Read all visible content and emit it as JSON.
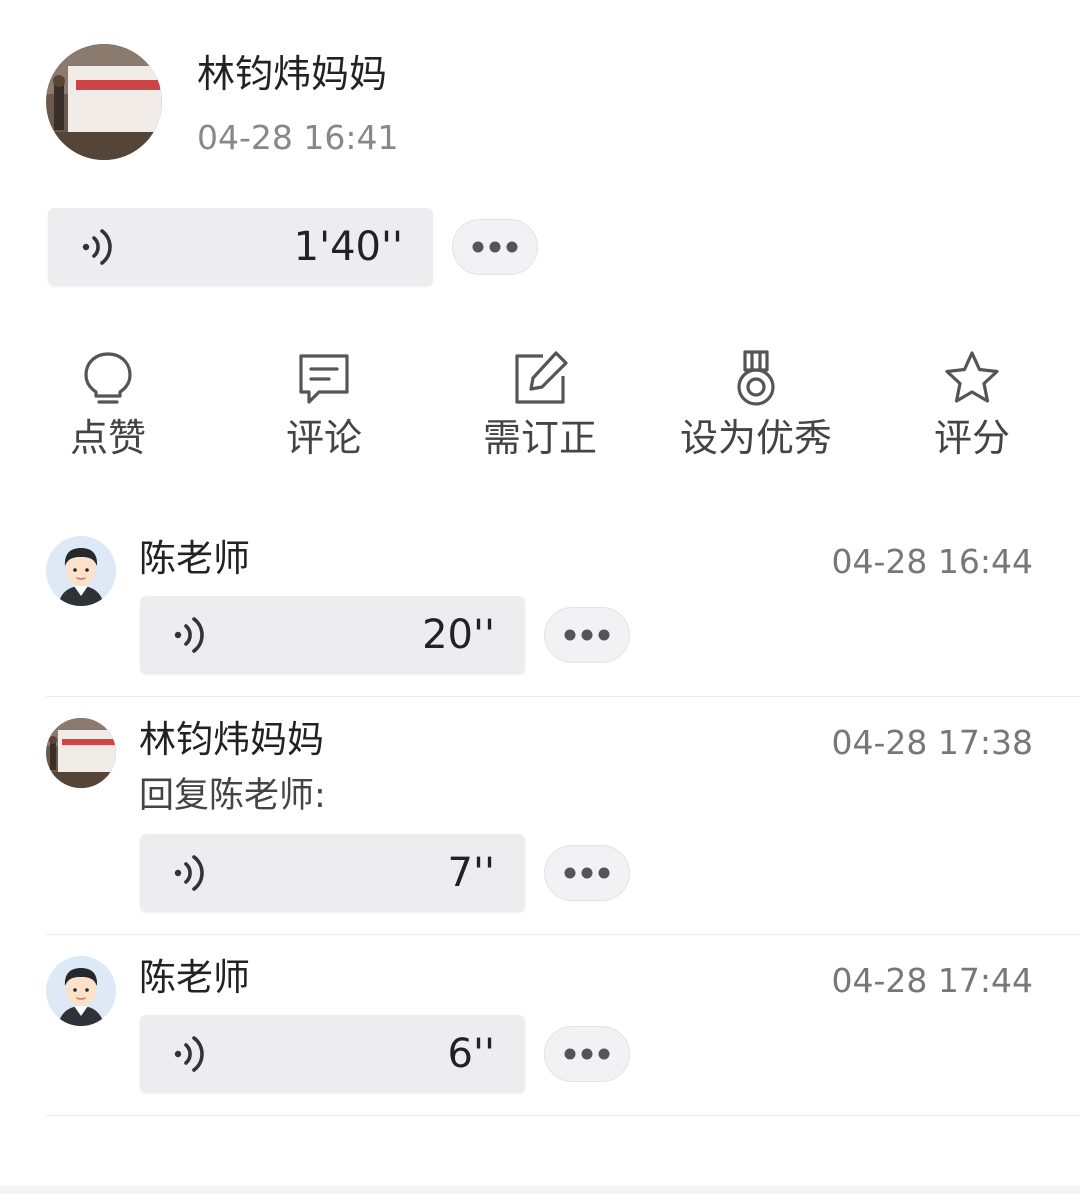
{
  "post": {
    "author": "林钧炜妈妈",
    "time": "04-28 16:41",
    "voice_duration": "1'40''",
    "avatar_icon": "photo-avatar"
  },
  "actions": [
    {
      "label": "点赞",
      "icon": "lightbulb-icon"
    },
    {
      "label": "评论",
      "icon": "comment-icon"
    },
    {
      "label": "需订正",
      "icon": "edit-icon"
    },
    {
      "label": "设为优秀",
      "icon": "medal-icon"
    },
    {
      "label": "评分",
      "icon": "star-icon"
    }
  ],
  "comments": [
    {
      "author": "陈老师",
      "time": "04-28 16:44",
      "voice_duration": "20''",
      "reply_to": "",
      "avatar_icon": "cartoon-teacher-avatar"
    },
    {
      "author": "林钧炜妈妈",
      "time": "04-28 17:38",
      "voice_duration": "7''",
      "reply_to": "回复陈老师:",
      "avatar_icon": "photo-avatar"
    },
    {
      "author": "陈老师",
      "time": "04-28 17:44",
      "voice_duration": "6''",
      "reply_to": "",
      "avatar_icon": "cartoon-teacher-avatar"
    }
  ],
  "colors": {
    "bubble_bg": "#ededef",
    "text_primary": "#222222",
    "text_secondary": "#888888",
    "banner_red": "#c8282a"
  }
}
